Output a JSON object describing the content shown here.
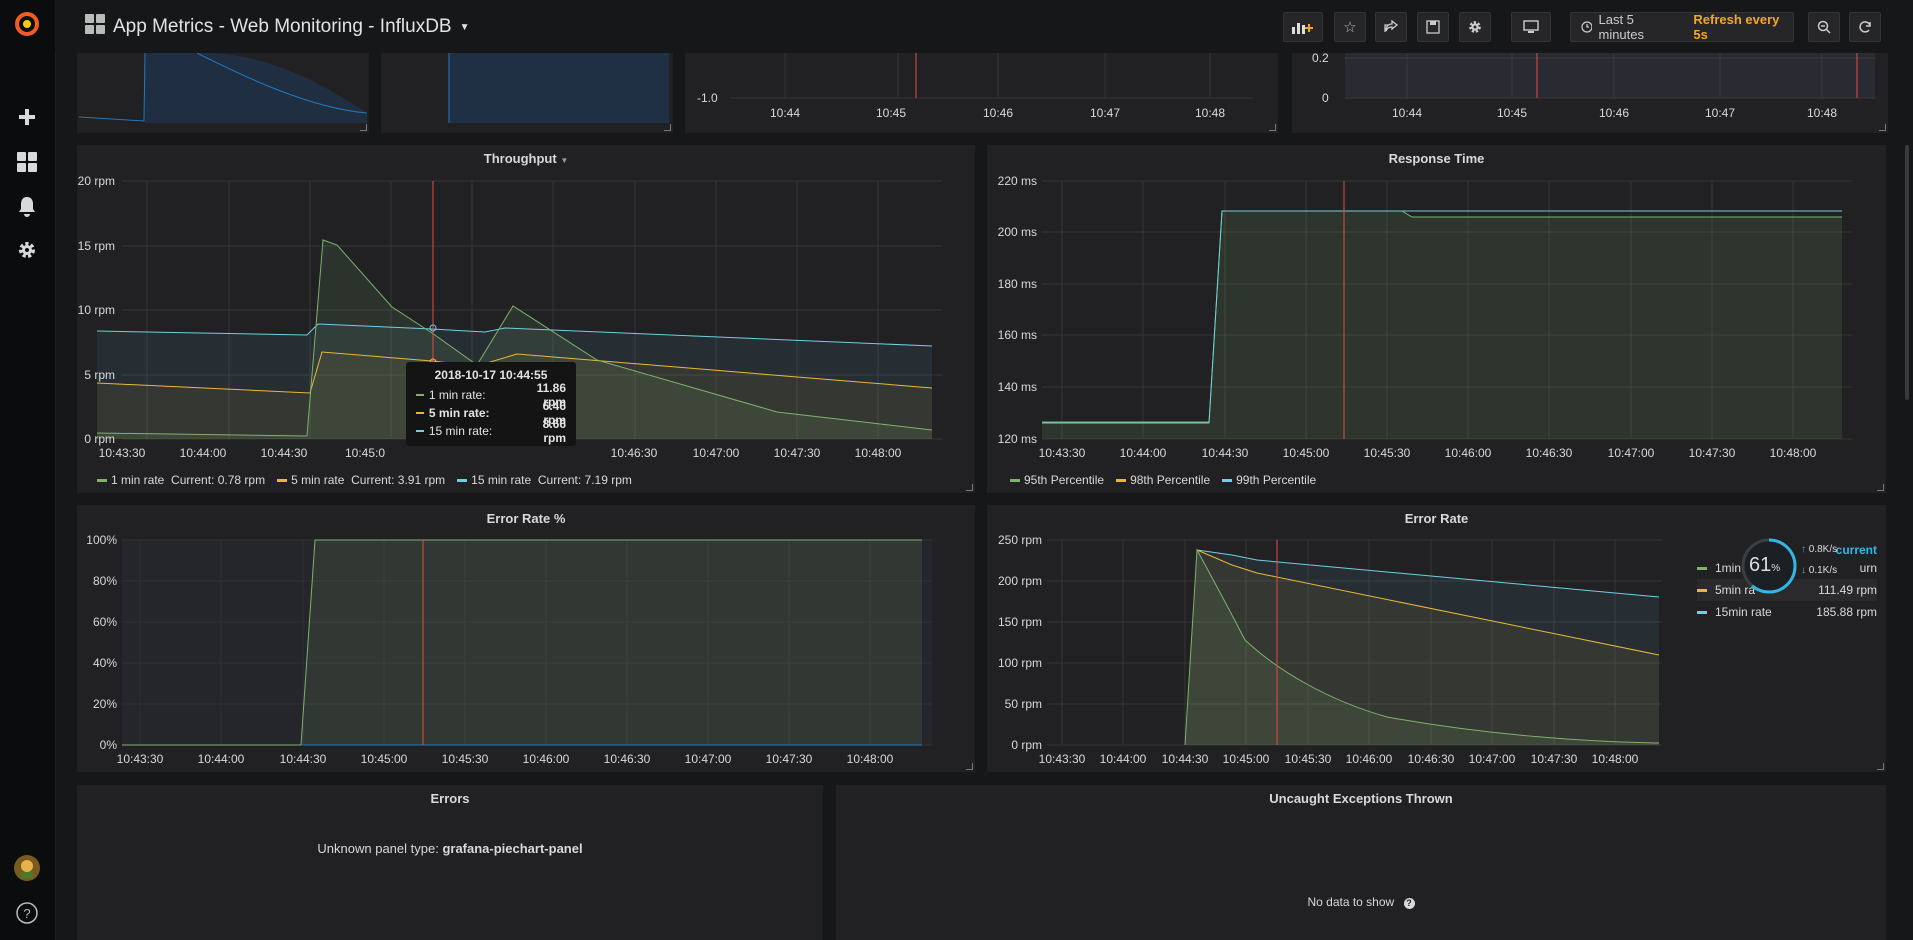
{
  "header": {
    "title": "App Metrics - Web Monitoring - InfluxDB",
    "time_range": "Last 5 minutes",
    "refresh": "Refresh every 5s"
  },
  "colors": {
    "green": "#7eb26d",
    "yellow": "#eab839",
    "cyan": "#6ed0e0",
    "orange": "#ef843c",
    "blue": "#1f78c1",
    "red": "#e24d42"
  },
  "top_panels": {
    "mid_ticks": [
      "-1.0"
    ],
    "mid_x_ticks": [
      "10:44",
      "10:45",
      "10:46",
      "10:47",
      "10:48"
    ],
    "right_y_ticks": [
      "0.2",
      "0"
    ],
    "right_x_ticks": [
      "10:44",
      "10:45",
      "10:46",
      "10:47",
      "10:48"
    ]
  },
  "throughput": {
    "title": "Throughput",
    "y_ticks": [
      "20 rpm",
      "15 rpm",
      "10 rpm",
      "5 rpm",
      "0 rpm"
    ],
    "x_ticks": [
      "10:43:30",
      "10:44:00",
      "10:44:30",
      "10:45:0",
      "",
      "10:46:30",
      "10:47:00",
      "10:47:30",
      "10:48:00"
    ],
    "legend": [
      {
        "name": "1 min rate",
        "current": "Current: 0.78 rpm"
      },
      {
        "name": "5 min rate",
        "current": "Current: 3.91 rpm"
      },
      {
        "name": "15 min rate",
        "current": "Current: 7.19 rpm"
      }
    ],
    "tooltip": {
      "time": "2018-10-17 10:44:55",
      "rows": [
        {
          "label": "1 min rate:",
          "value": "11.86 rpm"
        },
        {
          "label": "5 min rate:",
          "value": "6.46 rpm"
        },
        {
          "label": "15 min rate:",
          "value": "8.66 rpm"
        }
      ]
    }
  },
  "response_time": {
    "title": "Response Time",
    "y_ticks": [
      "220 ms",
      "200 ms",
      "180 ms",
      "160 ms",
      "140 ms",
      "120 ms"
    ],
    "x_ticks": [
      "10:43:30",
      "10:44:00",
      "10:44:30",
      "10:45:00",
      "10:45:30",
      "10:46:00",
      "10:46:30",
      "10:47:00",
      "10:47:30",
      "10:48:00"
    ],
    "legend": [
      "95th Percentile",
      "98th Percentile",
      "99th Percentile"
    ]
  },
  "error_rate_pct": {
    "title": "Error Rate %",
    "y_ticks": [
      "100%",
      "80%",
      "60%",
      "40%",
      "20%",
      "0%"
    ],
    "x_ticks": [
      "10:43:30",
      "10:44:00",
      "10:44:30",
      "10:45:00",
      "10:45:30",
      "10:46:00",
      "10:46:30",
      "10:47:00",
      "10:47:30",
      "10:48:00"
    ]
  },
  "error_rate": {
    "title": "Error Rate",
    "y_ticks": [
      "250 rpm",
      "200 rpm",
      "150 rpm",
      "100 rpm",
      "50 rpm",
      "0 rpm"
    ],
    "x_ticks": [
      "10:43:30",
      "10:44:00",
      "10:44:30",
      "10:45:00",
      "10:45:30",
      "10:46:00",
      "10:46:30",
      "10:47:00",
      "10:47:30",
      "10:48:00"
    ],
    "legend_header": "current",
    "legend": [
      {
        "name": "1min",
        "value": "urn"
      },
      {
        "name": "5min ra",
        "value": "111.49 rpm"
      },
      {
        "name": "15min rate",
        "value": "185.88 rpm"
      }
    ],
    "widget": {
      "percent": "61",
      "unit": "%",
      "up": "0.8K/s",
      "down": "0.1K/s"
    }
  },
  "errors_panel": {
    "title": "Errors",
    "message_prefix": "Unknown panel type: ",
    "message_type": "grafana-piechart-panel"
  },
  "exceptions_panel": {
    "title": "Uncaught Exceptions Thrown",
    "message": "No data to show"
  }
}
